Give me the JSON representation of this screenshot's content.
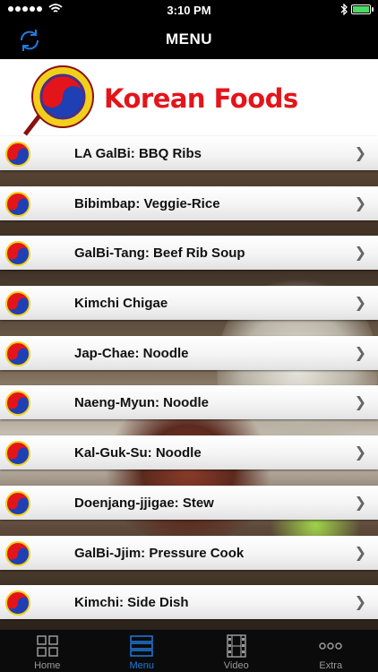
{
  "status_bar": {
    "time": "3:10 PM",
    "carrier": ""
  },
  "nav": {
    "title": "MENU"
  },
  "banner": {
    "title": "Korean Foods"
  },
  "menu_items": [
    {
      "label": "LA GalBi: BBQ Ribs"
    },
    {
      "label": "Bibimbap: Veggie-Rice"
    },
    {
      "label": "GalBi-Tang: Beef Rib Soup"
    },
    {
      "label": "Kimchi Chigae"
    },
    {
      "label": "Jap-Chae: Noodle"
    },
    {
      "label": "Naeng-Myun: Noodle"
    },
    {
      "label": "Kal-Guk-Su: Noodle"
    },
    {
      "label": "Doenjang-jjigae: Stew"
    },
    {
      "label": "GalBi-Jjim: Pressure Cook"
    },
    {
      "label": "Kimchi: Side Dish"
    }
  ],
  "tabs": [
    {
      "label": "Home",
      "icon": "grid-icon"
    },
    {
      "label": "Menu",
      "icon": "list-icon"
    },
    {
      "label": "Video",
      "icon": "film-icon"
    },
    {
      "label": "Extra",
      "icon": "more-icon"
    }
  ],
  "colors": {
    "accent": "#1f7be0",
    "brand_red": "#e3151a",
    "battery": "#4cd964"
  }
}
